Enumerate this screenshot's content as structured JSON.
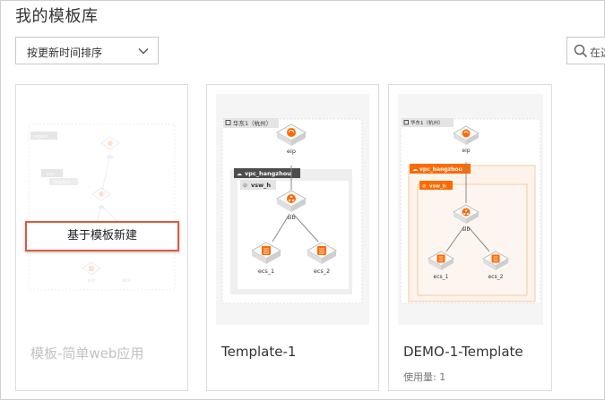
{
  "page": {
    "title": "我的模板库"
  },
  "toolbar": {
    "sort_label": "按更新时间排序",
    "search_placeholder": "在这"
  },
  "cards": [
    {
      "name": "模板-简单web应用",
      "action_label": "基于模板新建",
      "diagram": {
        "region": "region",
        "vpc": "vpc",
        "vsw": "vswitch",
        "eip": "eip",
        "slb": "slb",
        "ecs_1": "ecs",
        "ecs_2": "ecs"
      }
    },
    {
      "name": "Template-1",
      "diagram": {
        "region": "华东1（杭州）",
        "vpc": "vpc_hangzhou",
        "vsw": "vsw_h",
        "eip": "eip",
        "slb": "slb",
        "ecs_1": "ecs_1",
        "ecs_2": "ecs_2"
      }
    },
    {
      "name": "DEMO-1-Template",
      "usage": "使用量: 1",
      "diagram": {
        "region": "华东1（杭州）",
        "vpc": "vpc_hangzhou",
        "vsw": "vsw_h",
        "eip": "eip",
        "slb": "slb",
        "ecs_1": "ecs_1",
        "ecs_2": "ecs_2"
      }
    }
  ],
  "colors": {
    "accent": "#e0593d",
    "brand": "#ff6a00",
    "border": "#dcdcdc"
  }
}
